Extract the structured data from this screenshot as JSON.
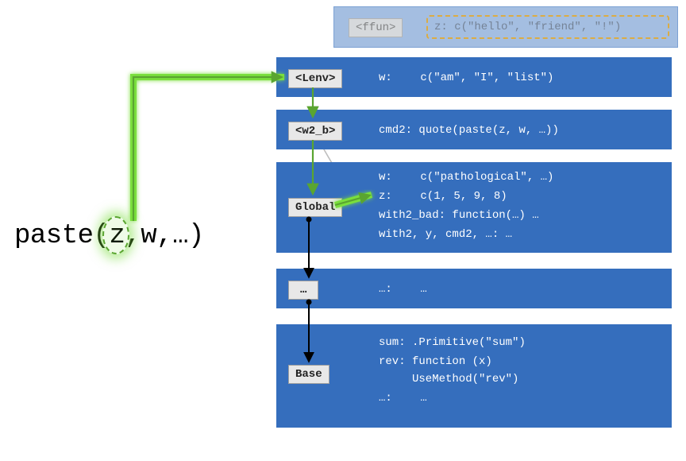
{
  "expression": {
    "func": "paste",
    "arg1": "z",
    "sep1": ",",
    "arg2": "w",
    "sep2": ",",
    "arg3": "…",
    "open": "(",
    "close": ")"
  },
  "top_overlay": {
    "tag": "<ffun>",
    "zdef": "z: c(\"hello\", \"friend\", \"!\")"
  },
  "frames": {
    "lenv": {
      "tag": "<Lenv>",
      "line1_key": "w:",
      "line1_val": "c(\"am\", \"I\", \"list\")"
    },
    "w2b": {
      "tag": "<w2_b>",
      "line1_key": "cmd2:",
      "line1_val": "quote(paste(z, w, …))"
    },
    "global": {
      "tag": "Global",
      "line1_key": "w:",
      "line1_val": "c(\"pathological\", …)",
      "line2_key": "z:",
      "line2_val": "c(1, 5, 9, 8)",
      "line3": "with2_bad: function(…) …",
      "line4": "with2, y, cmd2, …: …"
    },
    "dots": {
      "tag": "…",
      "line1_key": "…:",
      "line1_val": "…"
    },
    "base": {
      "tag": "Base",
      "line1_key": "sum:",
      "line1_val": ".Primitive(\"sum\")",
      "line2_key": "rev:",
      "line2_val": "function (x)",
      "line2b_val": "UseMethod(\"rev\")",
      "line3_key": "…:",
      "line3_val": "…"
    }
  },
  "colors": {
    "frame_bg": "#356ebd",
    "glow": "#7adf3c",
    "tag_bg": "#e8e8e8"
  }
}
